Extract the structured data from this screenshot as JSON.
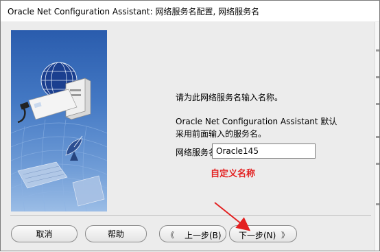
{
  "window": {
    "title": "Oracle Net Configuration Assistant: 网络服务名配置, 网络服务名"
  },
  "main": {
    "prompt": "请为此网络服务名输入名称。",
    "info_line1": "Oracle Net Configuration Assistant 默认",
    "info_line2": "采用前面输入的服务名。",
    "service_name_label": "网络服务名:",
    "service_name_value": "Oracle145"
  },
  "annotation": {
    "text": "自定义名称",
    "color": "#e32020"
  },
  "buttons": {
    "cancel": "取消",
    "help": "帮助",
    "back": "上一步(B)",
    "next": "下一步(N)",
    "back_arrow": "《",
    "next_arrow": "》"
  },
  "colors": {
    "side_image_top": "#2a5cad",
    "side_image_bottom": "#9bbde6"
  },
  "icons": [
    "globe-icon",
    "server-icon",
    "satellite-dish-icon",
    "keyboard-icon",
    "arrow-annotation-icon"
  ]
}
